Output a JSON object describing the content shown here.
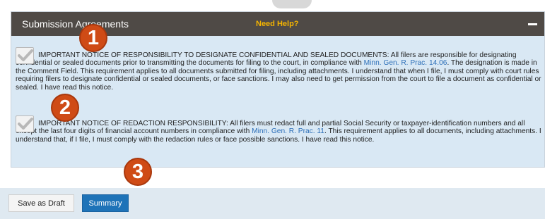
{
  "panel": {
    "title": "Submission Agreements",
    "help_link": "Need Help?",
    "collapse_icon": "minus-icon"
  },
  "notices": [
    {
      "checked": true,
      "text_before": "IMPORTANT NOTICE OF RESPONSIBILITY TO DESIGNATE CONFIDENTIAL AND SEALED DOCUMENTS: All filers are responsible for designating confidential or sealed documents prior to transmitting the documents for filing to the court, in compliance with ",
      "link": "Minn. Gen. R. Prac. 14.06",
      "text_after": ". The designation is made in the Comment Field. This requirement applies to all documents submitted for filing, including attachments. I understand that when I file, I must comply with court rules requiring filers to designate confidential or sealed documents, or face sanctions. I may also need to get permission from the court to file a document as confidential or sealed. I have read this notice."
    },
    {
      "checked": true,
      "text_before": "IMPORTANT NOTICE OF REDACTION RESPONSIBILITY: All filers must redact full and partial Social Security or taxpayer-identification numbers and all except the last four digits of financial account numbers in compliance with ",
      "link": "Minn. Gen. R. Prac. 11",
      "text_after": ". This requirement applies to all documents, including attachments. I understand that, if I file, I must comply with the redaction rules or face possible sanctions. I have read this notice."
    }
  ],
  "callouts": [
    "1",
    "2",
    "3"
  ],
  "footer": {
    "save_draft_label": "Save as Draft",
    "summary_label": "Summary"
  },
  "colors": {
    "header_bg": "#4f4a46",
    "panel_bg": "#d9e8f4",
    "help_link": "#f4b400",
    "link": "#2d6fb8",
    "callout": "#cf4b16",
    "primary_button": "#1e73b8"
  }
}
